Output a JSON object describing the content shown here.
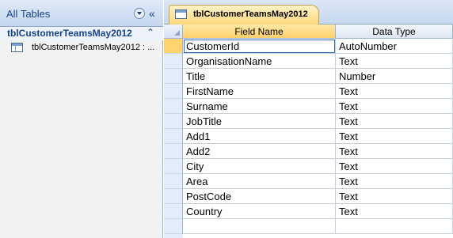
{
  "nav": {
    "title": "All Tables",
    "collapse_glyph": "«",
    "group": {
      "label": "tblCustomerTeamsMay2012",
      "chevron": "⌃"
    },
    "items": [
      {
        "label": "tblCustomerTeamsMay2012 : ...",
        "icon": "table-icon"
      }
    ]
  },
  "document": {
    "tab": {
      "label": "tblCustomerTeamsMay2012",
      "icon": "table-icon"
    },
    "columns": {
      "field_name": "Field Name",
      "data_type": "Data Type"
    },
    "rows": [
      {
        "field": "CustomerId",
        "type": "AutoNumber"
      },
      {
        "field": "OrganisationName",
        "type": "Text"
      },
      {
        "field": "Title",
        "type": "Number"
      },
      {
        "field": "FirstName",
        "type": "Text"
      },
      {
        "field": "Surname",
        "type": "Text"
      },
      {
        "field": "JobTitle",
        "type": "Text"
      },
      {
        "field": "Add1",
        "type": "Text"
      },
      {
        "field": "Add2",
        "type": "Text"
      },
      {
        "field": "City",
        "type": "Text"
      },
      {
        "field": "Area",
        "type": "Text"
      },
      {
        "field": "PostCode",
        "type": "Text"
      },
      {
        "field": "Country",
        "type": "Text"
      },
      {
        "field": "",
        "type": ""
      }
    ]
  },
  "colors": {
    "accent": "#ffd57a",
    "nav_text": "#15428b",
    "grid_border": "#9eb6d3"
  }
}
